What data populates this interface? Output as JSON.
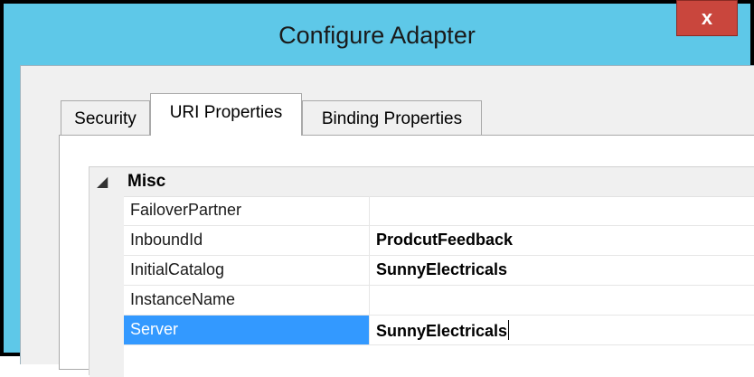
{
  "window": {
    "title": "Configure Adapter",
    "close_label": "x"
  },
  "tabs": [
    {
      "label": "Security",
      "active": false
    },
    {
      "label": "URI Properties",
      "active": true
    },
    {
      "label": "Binding Properties",
      "active": false
    }
  ],
  "property_grid": {
    "category": "Misc",
    "expander_glyph": "◢",
    "rows": [
      {
        "name": "FailoverPartner",
        "value": ""
      },
      {
        "name": "InboundId",
        "value": "ProdcutFeedback"
      },
      {
        "name": "InitialCatalog",
        "value": "SunnyElectricals"
      },
      {
        "name": "InstanceName",
        "value": ""
      },
      {
        "name": "Server",
        "value": "SunnyElectricals",
        "selected": true
      }
    ]
  },
  "colors": {
    "titlebar": "#5ec8e8",
    "close_button": "#c9463d",
    "selection": "#3399ff"
  }
}
